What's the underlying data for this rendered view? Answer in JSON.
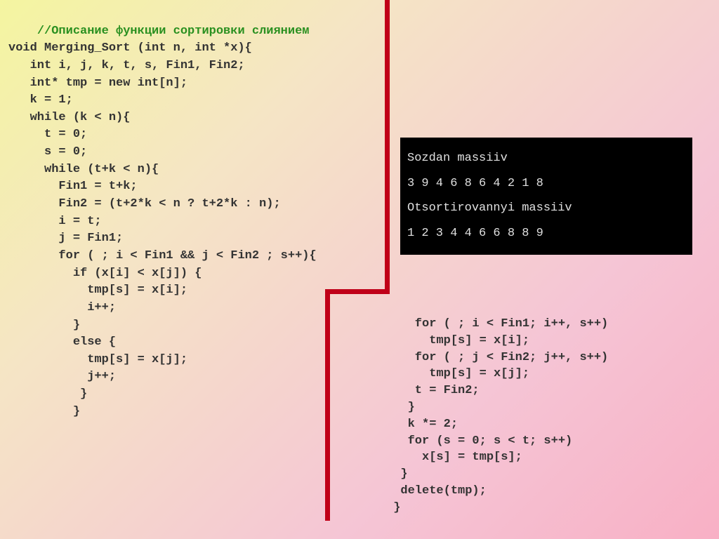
{
  "comment": "//Описание функции сортировки слиянием",
  "code_left": "void Merging_Sort (int n, int *x){\n   int i, j, k, t, s, Fin1, Fin2;\n   int* tmp = new int[n];\n   k = 1;\n   while (k < n){\n     t = 0;\n     s = 0;\n     while (t+k < n){\n       Fin1 = t+k;\n       Fin2 = (t+2*k < n ? t+2*k : n);\n       i = t;\n       j = Fin1;\n       for ( ; i < Fin1 && j < Fin2 ; s++){\n         if (x[i] < x[j]) {\n           tmp[s] = x[i];\n           i++;\n         }\n         else {\n           tmp[s] = x[j];\n           j++;\n          }\n         }",
  "terminal": {
    "line1": "Sozdan massiiv",
    "line2": "3 9 4 6 8 6 4 2 1 8",
    "line3": "Otsortirovannyi massiiv",
    "line4": "1 2 3 4 4 6 6 8 8 9"
  },
  "code_right": "    for ( ; i < Fin1; i++, s++)\n      tmp[s] = x[i];\n    for ( ; j < Fin2; j++, s++)\n      tmp[s] = x[j];\n    t = Fin2;\n   }\n   k *= 2;\n   for (s = 0; s < t; s++)\n     x[s] = tmp[s];\n  }\n  delete(tmp);\n }"
}
